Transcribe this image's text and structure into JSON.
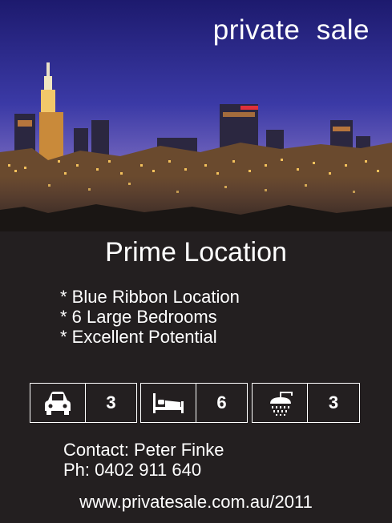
{
  "header": {
    "brand": "private  sale"
  },
  "hero": {
    "alt": "Night city skyline"
  },
  "headline": "Prime Location",
  "features": [
    "* Blue Ribbon Location",
    "* 6 Large Bedrooms",
    "* Excellent Potential"
  ],
  "stats": [
    {
      "icon": "car-icon",
      "value": "3"
    },
    {
      "icon": "bed-icon",
      "value": "6"
    },
    {
      "icon": "shower-icon",
      "value": "3"
    }
  ],
  "contact": {
    "name_line": "Contact: Peter Finke",
    "phone_line": "Ph: 0402 911 640"
  },
  "website": "www.privatesale.com.au/2011",
  "colors": {
    "background": "#231f20",
    "text": "#ffffff",
    "sky_top": "#2a2a8a",
    "sky_bottom": "#8a6fb5"
  }
}
